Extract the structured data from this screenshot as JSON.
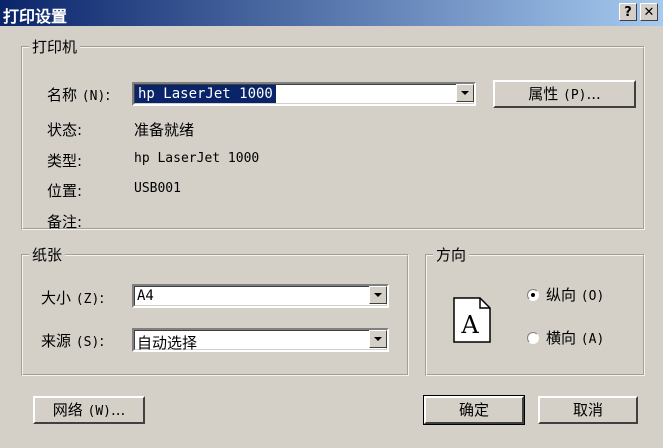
{
  "window": {
    "title": "打印设置",
    "help_glyph": "?",
    "close_glyph": "✕"
  },
  "printer_group": {
    "legend": "打印机",
    "name_label": "名称",
    "name_accel": "(N)",
    "name_value": "hp LaserJet 1000",
    "properties_button": "属性",
    "properties_accel": "(P)",
    "properties_suffix": "...",
    "status_label": "状态:",
    "status_value": "准备就绪",
    "type_label": "类型:",
    "type_value": "hp LaserJet 1000",
    "location_label": "位置:",
    "location_value": "USB001",
    "comment_label": "备注:"
  },
  "paper_group": {
    "legend": "纸张",
    "size_label": "大小",
    "size_accel": "(Z)",
    "size_value": "A4",
    "source_label": "来源",
    "source_accel": "(S)",
    "source_value": "自动选择"
  },
  "orientation_group": {
    "legend": "方向",
    "page_glyph": "A",
    "portrait_label": "纵向",
    "portrait_accel": "(O)",
    "landscape_label": "横向",
    "landscape_accel": "(A)",
    "selected": "portrait"
  },
  "buttons": {
    "network_label": "网络",
    "network_accel": "(W)",
    "network_suffix": "...",
    "ok_label": "确定",
    "cancel_label": "取消"
  }
}
